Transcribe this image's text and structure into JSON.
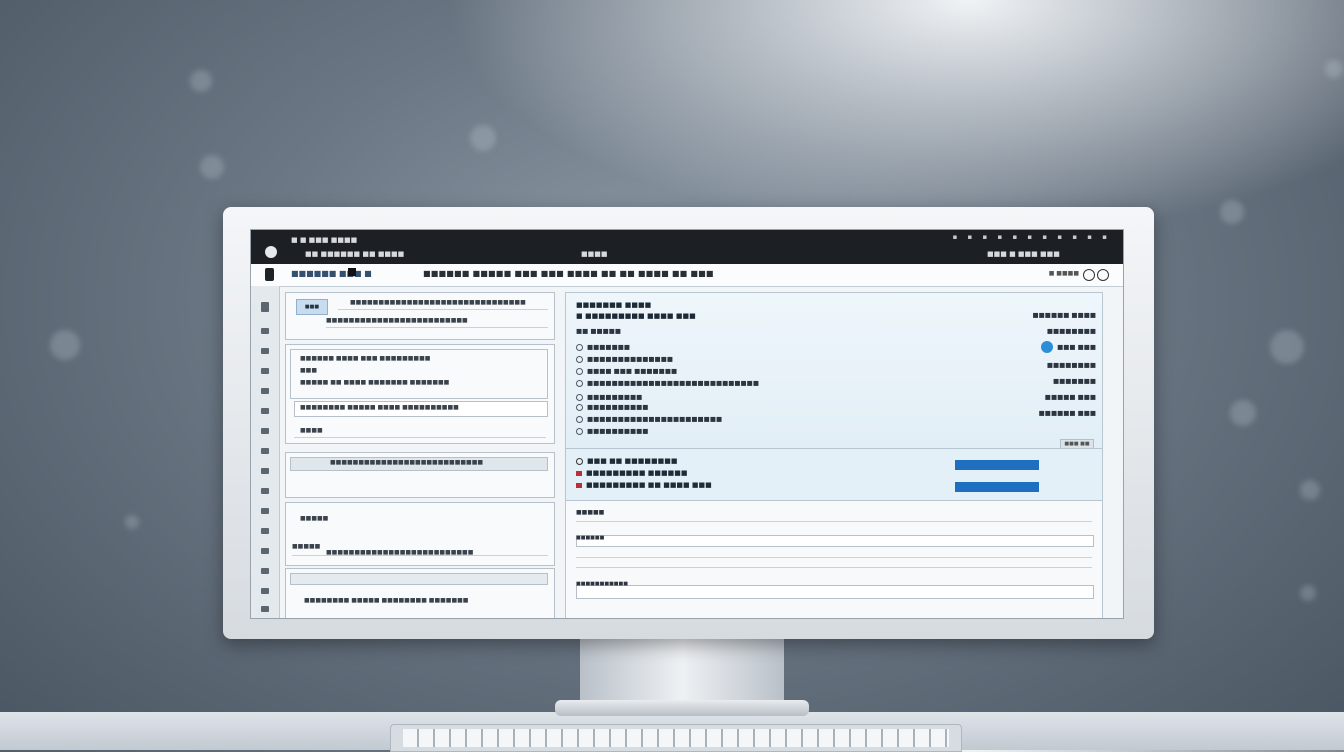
{
  "titlebar": {
    "app_name": "■ ■ ■■■ ■■■■",
    "menu": "■■ ■■■■■■ ■■ ■■■■",
    "center": "■■■■",
    "right": "■■■ ■ ■■■ ■■■",
    "window_controls": "▪ ▪ ▪ ▪ ▪ ▪ ▪ ▪ ▪ ▪ ▪"
  },
  "toolbar": {
    "left_label": "■■■■■■ ■■■ ■",
    "title": "■■■■■■ ■■■■■ ■■■ ■■■ ■■■■ ■■ ■■ ■■■■ ■■ ■■■",
    "right_label": "■ ■■■■"
  },
  "left": {
    "header_tag": "■■■",
    "header_row1": "■■■■■■■■■■■■■■■■■■■■■■■■■■■■■■■",
    "header_row2": "■■■■■■■■■■■■■■■■■■■■■■■■■",
    "group1_rows": [
      "■■■■■■ ■■■■ ■■■ ■■■■■■■■■",
      "■■■",
      "■■■■■ ■■ ■■■■ ■■■■■■■ ■■■■■■■",
      "■■■■■■■■ ■■■■■ ■■■■ ■■■■■■■■■■",
      "■■■■"
    ],
    "group2_row": "■■■■■■■■■■■■■■■■■■■■■■■■■■■",
    "group3_rows": [
      "■■■■■",
      "■■■■■",
      "■■■■■■■■■■■■■■■■■■■■■■■■■■"
    ],
    "group4_row": "■■■■■■■■ ■■■■■ ■■■■■■■■ ■■■■■■■"
  },
  "right": {
    "top_heading": "■■■■■■■ ■■■■",
    "top_subheading": "■ ■■■■■■■■■ ■■■■ ■■■",
    "items": [
      "■■ ■■■■■",
      "■■■■■■■",
      "■■■■■■■■■■■■■■",
      "■■■■ ■■■ ■■■■■■■",
      "■■■■■■■■■■■■■■■■■■■■■■■■■■■■",
      "■■■■■■■■■",
      "■■■■■■■■■■",
      "■■■■■■■■■■■■■■■■■■■■■■",
      "■■■■■■■■■■"
    ],
    "values": [
      "■■■■■■ ■■■■",
      "■■■■■■■■",
      "■■■ ■■■",
      "■■■■■■■■",
      "■■■■■■■",
      "■■■■■ ■■■",
      "■■■■■■ ■■■"
    ],
    "small_button": "■■■ ■■",
    "meters": [
      {
        "label": "■■■ ■■ ■■■■■■■■",
        "fill": 1.0
      },
      {
        "label": "■■■■■■■■■ ■■■■■■",
        "fill": 1.0
      },
      {
        "label": "■■■■■■■■■ ■■ ■■■■ ■■■",
        "fill": null
      }
    ],
    "bottom_label1": "■■■■■",
    "bottom_label2": "■■■■■■",
    "bottom_label3": "■■■■■■■■■■■"
  },
  "colors": {
    "accent": "#1f6fc0",
    "toggle": "#2a8fd8",
    "alert": "#b8303a",
    "titlebar": "#1c1f23"
  }
}
